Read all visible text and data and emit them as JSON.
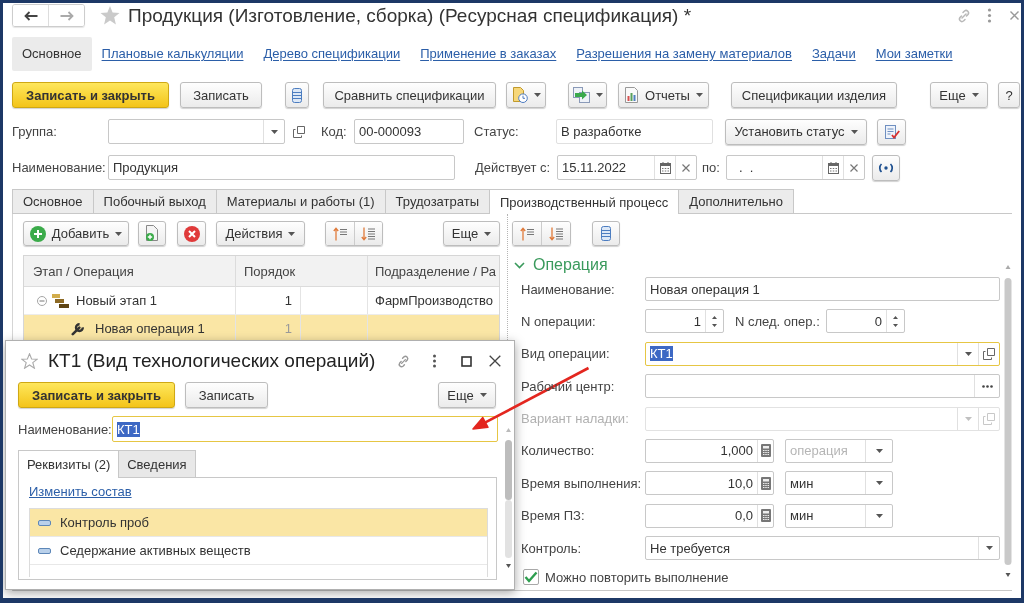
{
  "window": {
    "title": "Продукция (Изготовление, сборка) (Ресурсная спецификация) *"
  },
  "nav_panel": [
    {
      "label": "Основное",
      "selected": true
    },
    {
      "label": "Плановые калькуляции",
      "selected": false
    },
    {
      "label": "Дерево спецификации",
      "selected": false
    },
    {
      "label": "Применение в заказах",
      "selected": false
    },
    {
      "label": "Разрешения на замену материалов",
      "selected": false
    },
    {
      "label": "Задачи",
      "selected": false
    },
    {
      "label": "Мои заметки",
      "selected": false
    }
  ],
  "command_bar": {
    "save_and_close": "Записать и закрыть",
    "save": "Записать",
    "compare": "Сравнить спецификации",
    "reports": "Отчеты",
    "product_specifications": "Спецификации изделия",
    "more": "Еще",
    "help": "?"
  },
  "header": {
    "group": {
      "label": "Группа:"
    },
    "code": {
      "label": "Код:",
      "value": "00-000093"
    },
    "status": {
      "label": "Статус:",
      "value": "В разработке",
      "button": "Установить статус"
    },
    "name": {
      "label": "Наименование:",
      "value": "Продукция"
    },
    "valid_from": {
      "label": "Действует с:",
      "value": "15.11.2022"
    },
    "valid_to": {
      "label": "по:",
      "value": ".  ."
    }
  },
  "tabs": [
    {
      "label": "Основное",
      "selected": false
    },
    {
      "label": "Побочный выход",
      "selected": false
    },
    {
      "label": "Материалы и работы (1)",
      "selected": false
    },
    {
      "label": "Трудозатраты",
      "selected": false
    },
    {
      "label": "Производственный процесс",
      "selected": true
    },
    {
      "label": "Дополнительно",
      "selected": false
    }
  ],
  "stages": {
    "toolbar": {
      "add": "Добавить",
      "actions": "Действия",
      "more": "Еще"
    },
    "columns": [
      "Этап / Операция",
      "Порядок",
      "Подразделение / Ра"
    ],
    "rows": [
      {
        "kind": "stage",
        "expanded": true,
        "selected": false,
        "name": "Новый этап 1",
        "order": "1",
        "department": "ФармПроизводство",
        "children": [
          {
            "kind": "operation",
            "selected": true,
            "name": "Новая операция 1",
            "order": "1"
          }
        ]
      }
    ]
  },
  "operation_form": {
    "title": "Операция",
    "expanded": true,
    "fields": [
      {
        "kind": "text",
        "label": "Наименование:",
        "value": "Новая операция 1",
        "focused": false,
        "disabled": false
      },
      {
        "kind": "spin_pair",
        "label": "N операции:",
        "value": "1",
        "second_label": "N след. опер.:",
        "second_value": "0",
        "focused": false,
        "disabled": false
      },
      {
        "kind": "select",
        "label": "Вид операции:",
        "value": "КТ1",
        "open_button": true,
        "focused": true,
        "disabled": false
      },
      {
        "kind": "choice",
        "label": "Рабочий центр:",
        "focused": false,
        "disabled": false
      },
      {
        "kind": "select",
        "label": "Вариант наладки:",
        "open_button": true,
        "focused": false,
        "disabled": true
      },
      {
        "kind": "quantity",
        "label": "Количество:",
        "value": "1,000",
        "unit": {
          "placeholder": "операция"
        },
        "focused": false,
        "disabled": false
      },
      {
        "kind": "quantity",
        "label": "Время выполнения:",
        "value": "10,0",
        "unit": {
          "value": "мин"
        },
        "focused": false,
        "disabled": false
      },
      {
        "kind": "quantity",
        "label": "Время ПЗ:",
        "value": "0,0",
        "unit": {
          "value": "мин"
        },
        "focused": false,
        "disabled": false
      },
      {
        "kind": "select",
        "label": "Контроль:",
        "value": "Не требуется",
        "open_button": false,
        "focused": false,
        "disabled": false
      },
      {
        "kind": "checkbox",
        "label": "Можно повторить выполнение",
        "checked": true,
        "focused": false,
        "disabled": false
      }
    ]
  },
  "dialog": {
    "title": "КТ1 (Вид технологических операций)",
    "buttons": {
      "save_and_close": "Записать и закрыть",
      "save": "Записать",
      "more": "Еще"
    },
    "name": {
      "label": "Наименование:",
      "value": "КТ1",
      "focused": true
    },
    "tabs": [
      {
        "label": "Реквизиты (2)",
        "selected": true
      },
      {
        "label": "Сведения",
        "selected": false
      }
    ],
    "change_link": "Изменить состав",
    "attributes": [
      {
        "name": "Контроль проб",
        "selected": true
      },
      {
        "name": "Седержание активных веществ",
        "selected": false
      }
    ]
  }
}
